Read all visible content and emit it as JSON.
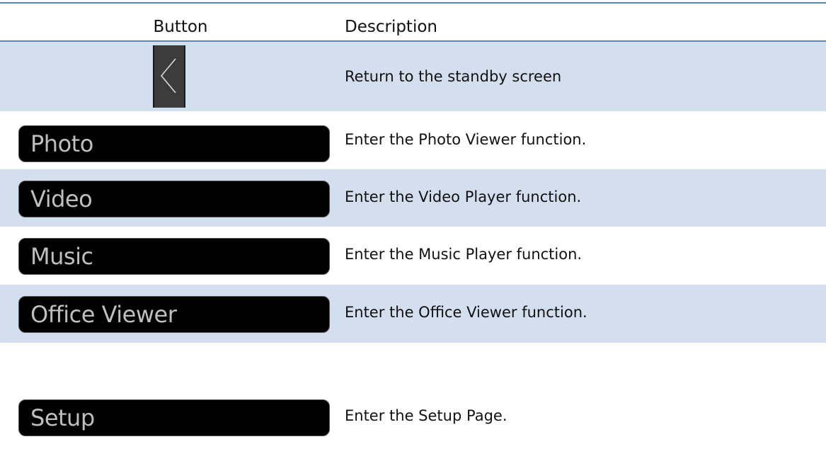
{
  "table": {
    "headers": {
      "button": "Button",
      "description": "Description"
    },
    "rows": [
      {
        "button_icon": "chevron-left-icon",
        "button_label": "",
        "description": "Return to the standby screen"
      },
      {
        "button_icon": "",
        "button_label": "Photo",
        "description": "Enter the Photo Viewer function."
      },
      {
        "button_icon": "",
        "button_label": "Video",
        "description": "Enter the Video Player function."
      },
      {
        "button_icon": "",
        "button_label": "Music",
        "description": "Enter the Music Player function."
      },
      {
        "button_icon": "",
        "button_label": "Office Viewer",
        "description": "Enter the Office Viewer function."
      },
      {
        "button_icon": "",
        "button_label": "Setup",
        "description": "Enter the Setup Page."
      }
    ]
  },
  "colors": {
    "rule": "#5b86ba",
    "row_shade": "#d3dfee",
    "button_bg": "#000000",
    "button_text": "#bfbfbf",
    "back_button_bg": "#3c3c3c"
  }
}
